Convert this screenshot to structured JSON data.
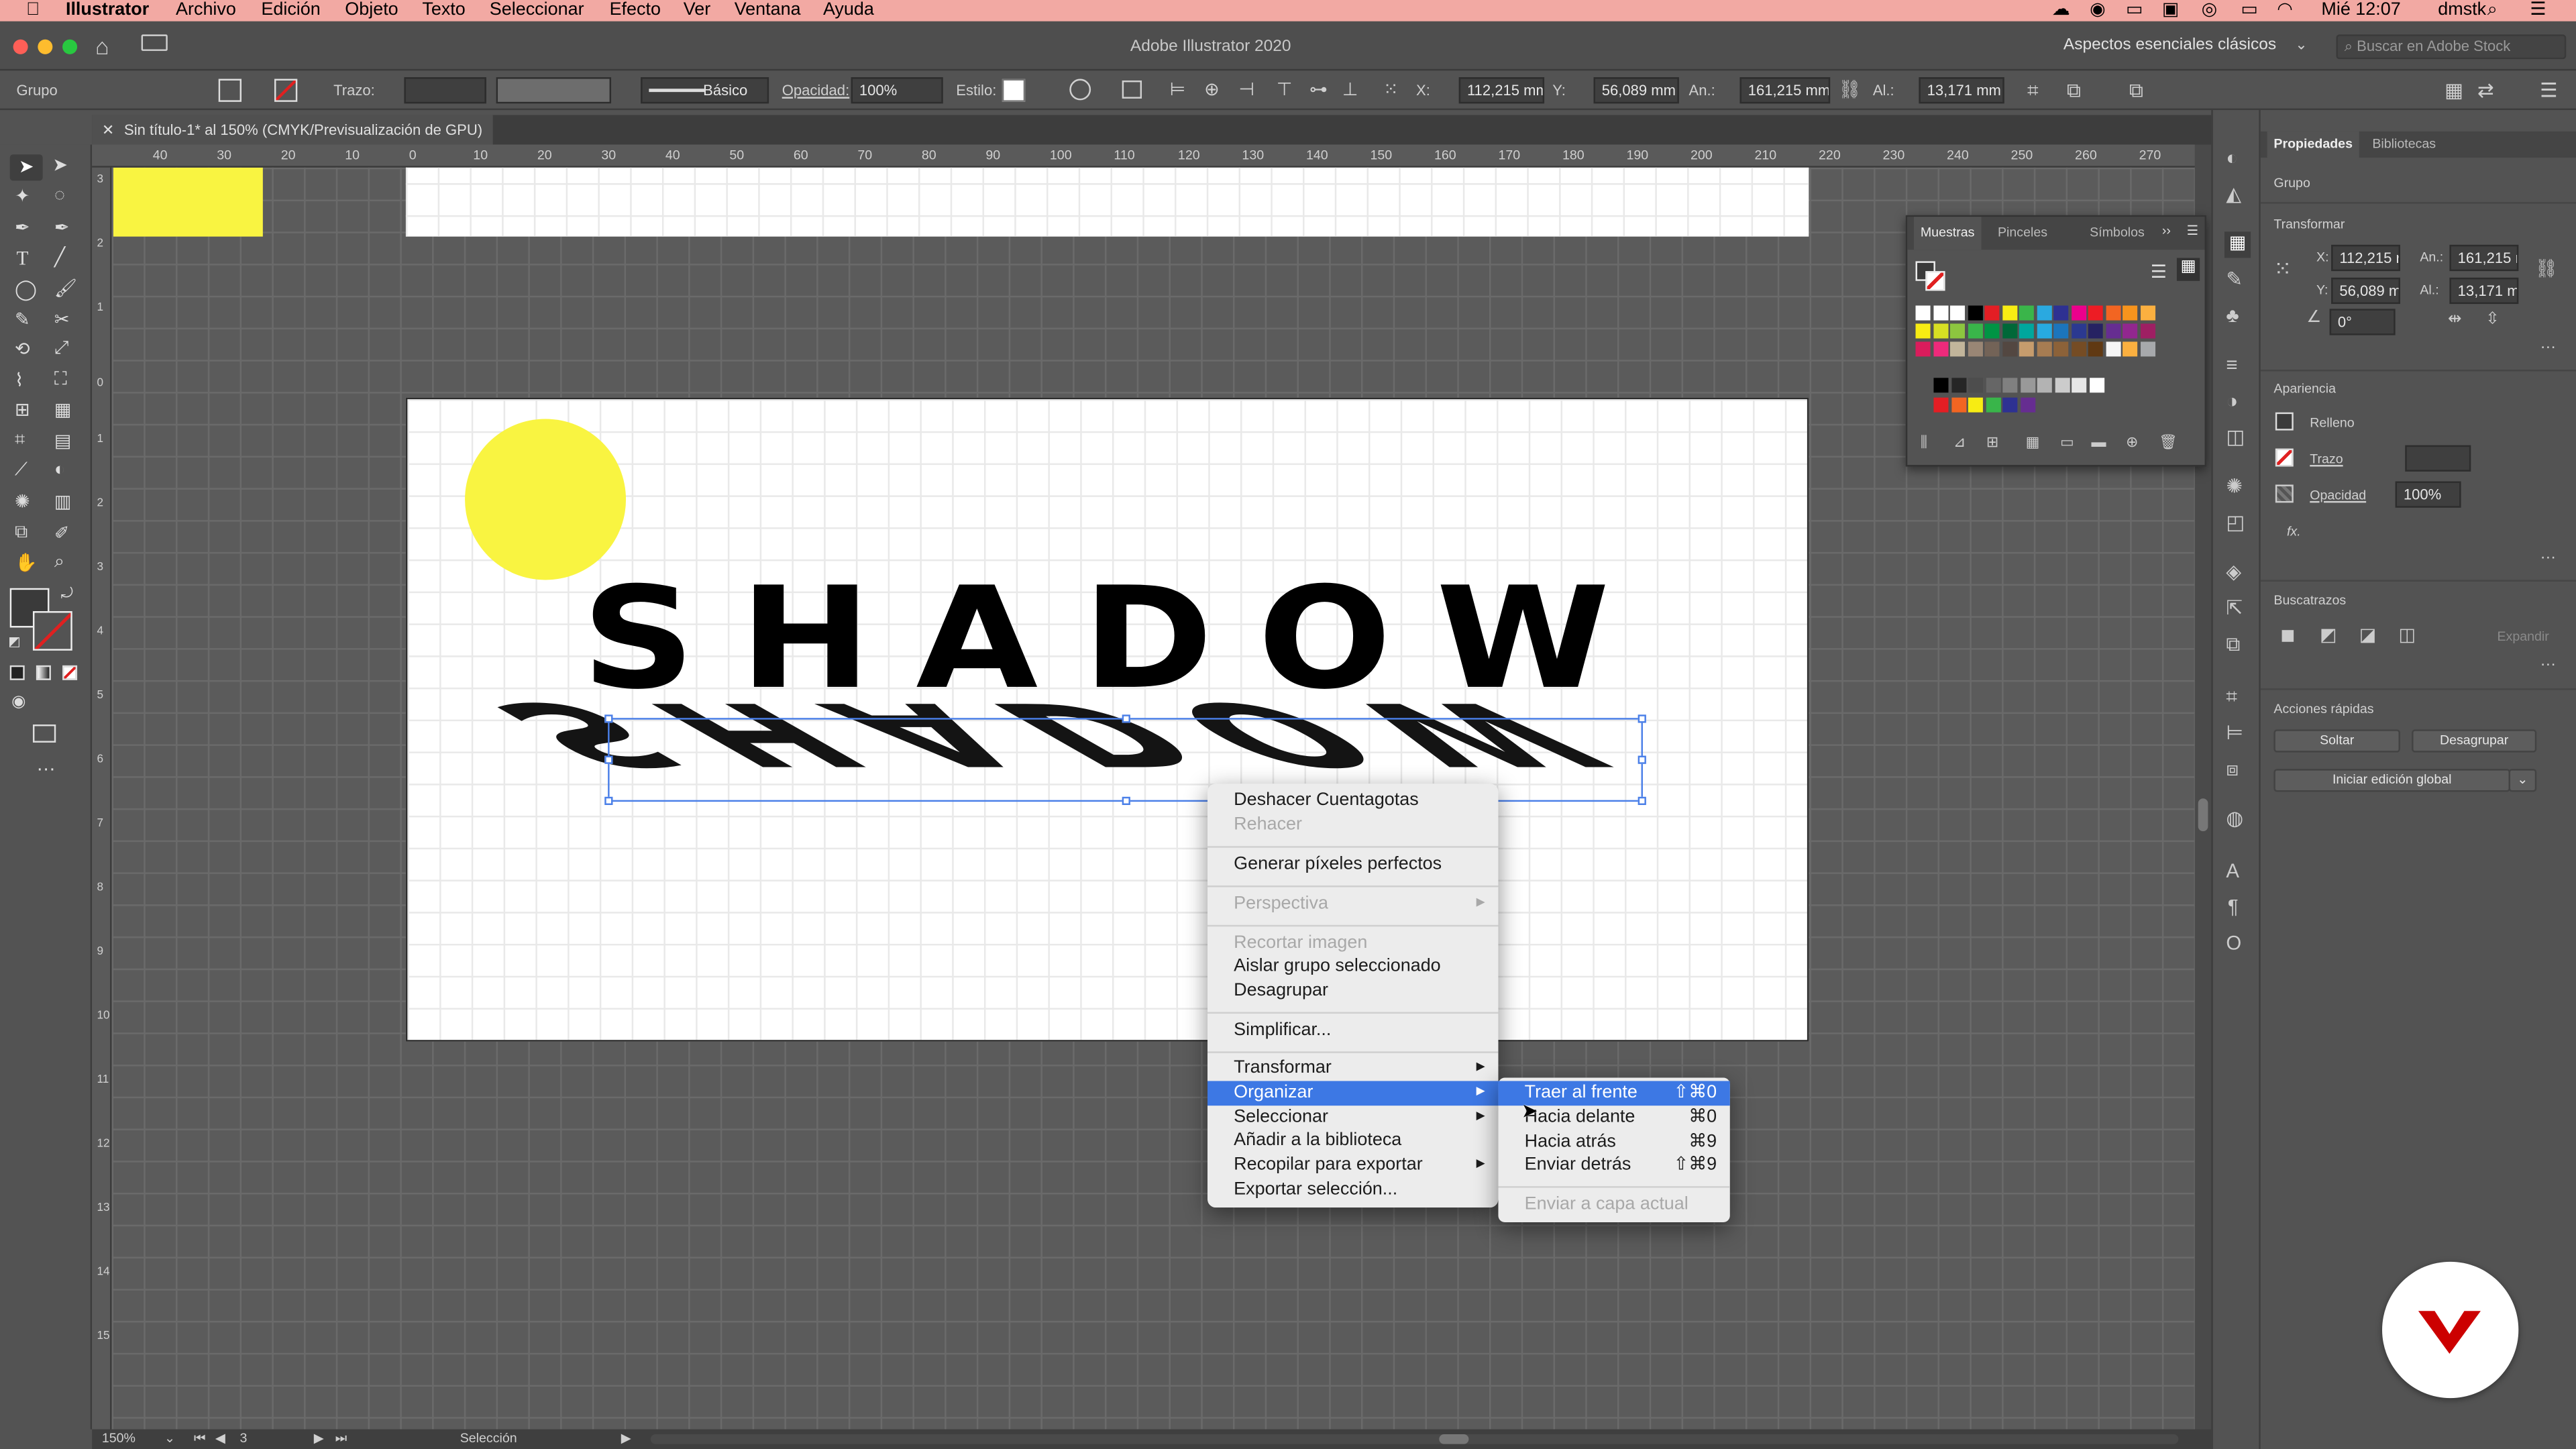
{
  "menubar": {
    "app": "Illustrator",
    "items": [
      "Archivo",
      "Edición",
      "Objeto",
      "Texto",
      "Seleccionar",
      "Efecto",
      "Ver",
      "Ventana",
      "Ayuda"
    ],
    "clock": "Mié 12:07",
    "user": "dmstk"
  },
  "titlebar": {
    "title": "Adobe Illustrator 2020",
    "workspace": "Aspectos esenciales clásicos",
    "search_placeholder": "Buscar en Adobe Stock"
  },
  "control": {
    "selection": "Grupo",
    "stroke_label": "Trazo:",
    "brush": "Básico",
    "opacity_label": "Opacidad:",
    "opacity": "100%",
    "style_label": "Estilo:",
    "x_label": "X:",
    "x": "112,215 mm",
    "y_label": "Y:",
    "y": "56,089 mm",
    "w_label": "An.:",
    "w": "161,215 mm",
    "h_label": "Al.:",
    "h": "13,171 mm"
  },
  "document": {
    "tab": "Sin título-1* al 150% (CMYK/Previsualización de GPU)"
  },
  "ruler": {
    "h": [
      "40",
      "30",
      "20",
      "10",
      "0",
      "10",
      "20",
      "30",
      "40",
      "50",
      "60",
      "70",
      "80",
      "90",
      "100",
      "110",
      "120",
      "130",
      "140",
      "150",
      "160",
      "170",
      "180",
      "190",
      "200",
      "210",
      "220",
      "230",
      "240",
      "250",
      "260",
      "270"
    ],
    "v": [
      "3",
      "2",
      "1",
      "0",
      "1",
      "2",
      "3",
      "4",
      "5",
      "6",
      "7",
      "8",
      "9",
      "10",
      "11",
      "12",
      "13",
      "14",
      "15"
    ]
  },
  "artwork": {
    "text": "SHADOW",
    "shadow": "SHADOW",
    "sun_color": "#f9f441",
    "rect_color": "#f9f441"
  },
  "context_menu": {
    "items": [
      {
        "label": "Deshacer Cuentagotas",
        "enabled": true
      },
      {
        "label": "Rehacer",
        "enabled": false
      },
      {
        "label": "Generar píxeles perfectos",
        "enabled": true
      },
      {
        "label": "Perspectiva",
        "enabled": false
      },
      {
        "label": "Recortar imagen",
        "enabled": false
      },
      {
        "label": "Aislar grupo seleccionado",
        "enabled": true
      },
      {
        "label": "Desagrupar",
        "enabled": true
      },
      {
        "label": "Simplificar...",
        "enabled": true
      },
      {
        "label": "Transformar",
        "enabled": true
      },
      {
        "label": "Organizar",
        "enabled": true,
        "highlighted": true
      },
      {
        "label": "Seleccionar",
        "enabled": true
      },
      {
        "label": "Añadir a la biblioteca",
        "enabled": true
      },
      {
        "label": "Recopilar para exportar",
        "enabled": true
      },
      {
        "label": "Exportar selección...",
        "enabled": true
      }
    ]
  },
  "submenu": {
    "items": [
      {
        "label": "Traer al frente",
        "shortcut": "⇧⌘0",
        "highlighted": true
      },
      {
        "label": "Hacia delante",
        "shortcut": "⌘0"
      },
      {
        "label": "Hacia atrás",
        "shortcut": "⌘9"
      },
      {
        "label": "Enviar detrás",
        "shortcut": "⇧⌘9"
      },
      {
        "label": "Enviar a capa actual",
        "enabled": false
      }
    ]
  },
  "swatches": {
    "tabs": [
      "Muestras",
      "Pinceles",
      "Símbolos"
    ]
  },
  "properties": {
    "tabs": [
      "Propiedades",
      "Bibliotecas"
    ],
    "group": "Grupo",
    "transform": "Transformar",
    "x_label": "X:",
    "x": "112,215 r",
    "w_label": "An.:",
    "w": "161,215 r",
    "y_label": "Y:",
    "y": "56,089 m",
    "h_label": "Al.:",
    "h": "13,171 m",
    "angle": "0°",
    "appearance": "Apariencia",
    "fill": "Relleno",
    "stroke": "Trazo",
    "opacity_label": "Opacidad",
    "opacity": "100%",
    "fx": "fx.",
    "pathfinder": "Buscatrazos",
    "expand": "Expandir",
    "quick_actions": "Acciones rápidas",
    "release": "Soltar",
    "ungroup": "Desagrupar",
    "global_edit": "Iniciar edición global"
  },
  "status": {
    "zoom": "150%",
    "artboard": "3",
    "tool": "Selección"
  },
  "colors": {
    "menubar": "#f2a9a3",
    "highlight": "#3d78e4",
    "yellow": "#f9f441",
    "logo": "#cc0000"
  }
}
